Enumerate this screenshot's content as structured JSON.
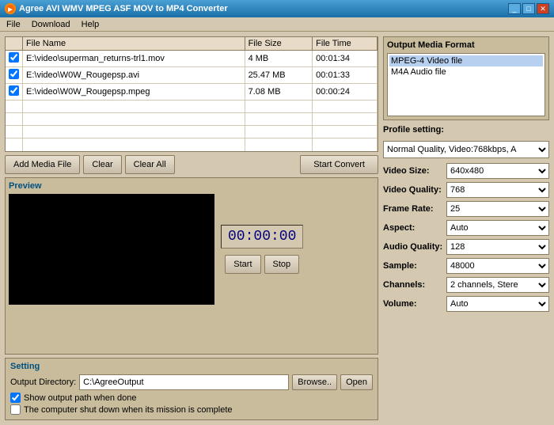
{
  "titlebar": {
    "title": "Agree AVI WMV MPEG ASF MOV to MP4 Converter",
    "icon": "●",
    "min_btn": "_",
    "max_btn": "□",
    "close_btn": "✕"
  },
  "menu": {
    "items": [
      "File",
      "Download",
      "Help"
    ]
  },
  "file_table": {
    "headers": [
      "File Name",
      "File Size",
      "File Time"
    ],
    "rows": [
      {
        "checked": true,
        "name": "E:\\video\\superman_returns-trl1.mov",
        "size": "4 MB",
        "time": "00:01:34"
      },
      {
        "checked": true,
        "name": "E:\\video\\W0W_Rougepsp.avi",
        "size": "25.47 MB",
        "time": "00:01:33"
      },
      {
        "checked": true,
        "name": "E:\\video\\W0W_Rougepsp.mpeg",
        "size": "7.08 MB",
        "time": "00:00:24"
      }
    ]
  },
  "buttons": {
    "add_media": "Add Media File",
    "clear": "Clear",
    "clear_all": "Clear All",
    "start_convert": "Start Convert"
  },
  "preview": {
    "label": "Preview",
    "time": "00:00:00",
    "start_btn": "Start",
    "stop_btn": "Stop"
  },
  "setting": {
    "label": "Setting",
    "output_dir_label": "Output Directory:",
    "output_dir_value": "C:\\AgreeOutput",
    "browse_btn": "Browse..",
    "open_btn": "Open",
    "checkbox1": "Show output path when done",
    "checkbox2": "The computer shut down when its mission is complete"
  },
  "output_format": {
    "title": "Output Media Format",
    "formats": [
      "MPEG-4 Video file",
      "M4A Audio file"
    ]
  },
  "profile": {
    "label": "Profile setting:",
    "value": "Normal Quality, Video:768kbps, A"
  },
  "video_settings": {
    "video_size": {
      "label": "Video Size:",
      "value": "640x480"
    },
    "video_quality": {
      "label": "Video Quality:",
      "value": "768"
    },
    "frame_rate": {
      "label": "Frame Rate:",
      "value": "25"
    },
    "aspect": {
      "label": "Aspect:",
      "value": "Auto"
    },
    "audio_quality": {
      "label": "Audio Quality:",
      "value": "128"
    },
    "sample": {
      "label": "Sample:",
      "value": "48000"
    },
    "channels": {
      "label": "Channels:",
      "value": "2 channels, Stere"
    },
    "volume": {
      "label": "Volume:",
      "value": "Auto"
    }
  }
}
